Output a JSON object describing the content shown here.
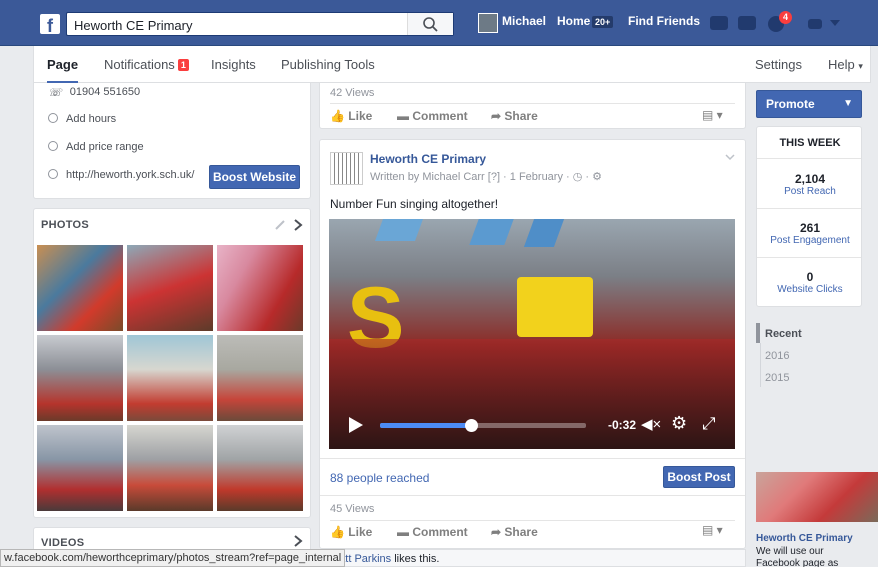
{
  "topbar": {
    "search_value": "Heworth CE Primary",
    "user_name": "Michael",
    "home_label": "Home",
    "home_badge": "20+",
    "find_friends": "Find Friends",
    "notif_badge": "4"
  },
  "subnav": {
    "tabs": [
      {
        "label": "Page"
      },
      {
        "label": "Notifications",
        "badge": "1"
      },
      {
        "label": "Insights"
      },
      {
        "label": "Publishing Tools"
      }
    ],
    "settings": "Settings",
    "help": "Help"
  },
  "about": {
    "phone": "01904 551650",
    "add_hours": "Add hours",
    "add_price": "Add price range",
    "website": "http://heworth.york.sch.uk/",
    "boost_website": "Boost Website"
  },
  "photos": {
    "title": "PHOTOS"
  },
  "videos": {
    "title": "VIDEOS"
  },
  "post_prev": {
    "views": "42 Views",
    "like": "Like",
    "comment": "Comment",
    "share": "Share"
  },
  "post": {
    "page_name": "Heworth CE Primary",
    "byline": "Written by Michael Carr [?] · 1 February · ◷ · ⚙",
    "text": "Number Fun singing altogether!",
    "time_left": "-0:32",
    "progress": 0.44,
    "reached": "88 people reached",
    "boost_post": "Boost Post",
    "views": "45 Views",
    "like": "Like",
    "comment": "Comment",
    "share": "Share",
    "likes_line_name": "Matt Parkins",
    "likes_line_rest": " likes this."
  },
  "right": {
    "promote": "Promote",
    "this_week": "THIS WEEK",
    "post_reach_num": "2,104",
    "post_reach_lbl": "Post Reach",
    "engagement_num": "261",
    "engagement_lbl": "Post Engagement",
    "clicks_num": "0",
    "clicks_lbl": "Website Clicks",
    "years": [
      "Recent",
      "2016",
      "2015"
    ],
    "promo_title": "Heworth CE Primary",
    "promo_text": "We will use our Facebook page as another tool to"
  },
  "status_url": "w.facebook.com/heworthceprimary/photos_stream?ref=page_internal"
}
